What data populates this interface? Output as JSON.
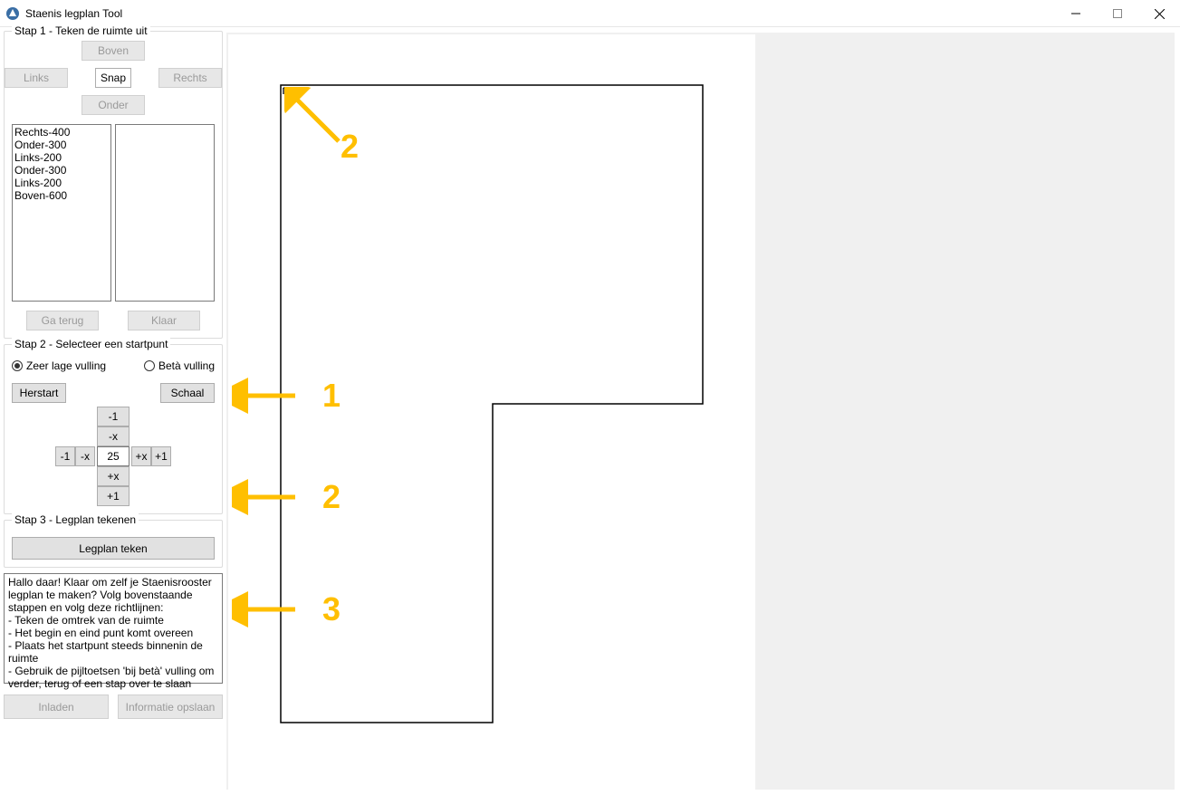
{
  "window": {
    "title": "Staenis legplan Tool"
  },
  "step1": {
    "legend": "Stap 1 - Teken de ruimte uit",
    "btn_top": "Boven",
    "btn_left": "Links",
    "btn_snap": "Snap",
    "btn_right": "Rechts",
    "btn_bottom": "Onder",
    "list_left": [
      "Rechts-400",
      "Onder-300",
      "Links-200",
      "Onder-300",
      "Links-200",
      "Boven-600"
    ],
    "btn_back": "Ga terug",
    "btn_done": "Klaar"
  },
  "step2": {
    "legend": "Stap 2 - Selecteer een startpunt",
    "radio_low": "Zeer lage vulling",
    "radio_beta": "Betà vulling",
    "radio_selected": "low",
    "btn_restart": "Herstart",
    "btn_scale": "Schaal",
    "stepper_value": "25",
    "minus1": "-1",
    "minusx": "-x",
    "plusx": "+x",
    "plus1": "+1"
  },
  "step3": {
    "legend": "Stap 3 - Legplan tekenen",
    "btn_draw": "Legplan teken"
  },
  "info": {
    "text": "Hallo daar! Klaar om zelf je Staenisrooster legplan te maken? Volg bovenstaande stappen en volg deze richtlijnen:\n- Teken de omtrek van de ruimte\n- Het begin en eind punt komt overeen\n- Plaats het startpunt steeds binnenin de ruimte\n- Gebruik de pijltoetsen 'bij betà' vulling om verder, terug of een stap over te slaan"
  },
  "bottom": {
    "btn_load": "Inladen",
    "btn_save": "Informatie opslaan"
  },
  "annotations": {
    "one": "1",
    "two": "2",
    "two_b": "2",
    "three": "3"
  }
}
